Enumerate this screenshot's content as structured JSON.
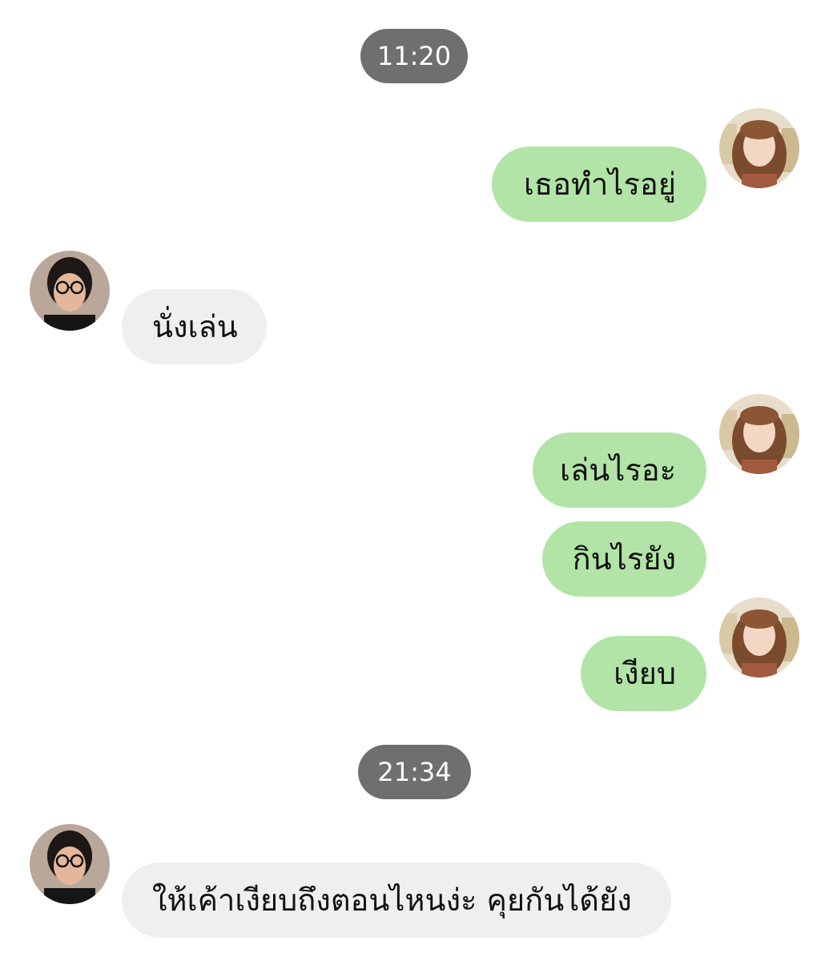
{
  "chat": {
    "timestamps": [
      "11:20",
      "21:34"
    ],
    "messages": [
      {
        "sender": "me",
        "text": "เธอทำไรอยู่"
      },
      {
        "sender": "them",
        "text": "นั่งเล่น"
      },
      {
        "sender": "me",
        "text": "เล่นไรอะ"
      },
      {
        "sender": "me",
        "text": "กินไรยัง"
      },
      {
        "sender": "me",
        "text": "เงียบ"
      },
      {
        "sender": "them",
        "text": "ให้เค้าเงียบถึงตอนไหนง่ะ คุยกันได้ยัง"
      }
    ]
  },
  "colors": {
    "outgoing_bubble": "#b1e4a6",
    "incoming_bubble": "#efefef",
    "timestamp_pill": "#6f6f6f"
  },
  "icons": {
    "my_avatar": "avatar-long-hair",
    "their_avatar": "avatar-glasses"
  }
}
